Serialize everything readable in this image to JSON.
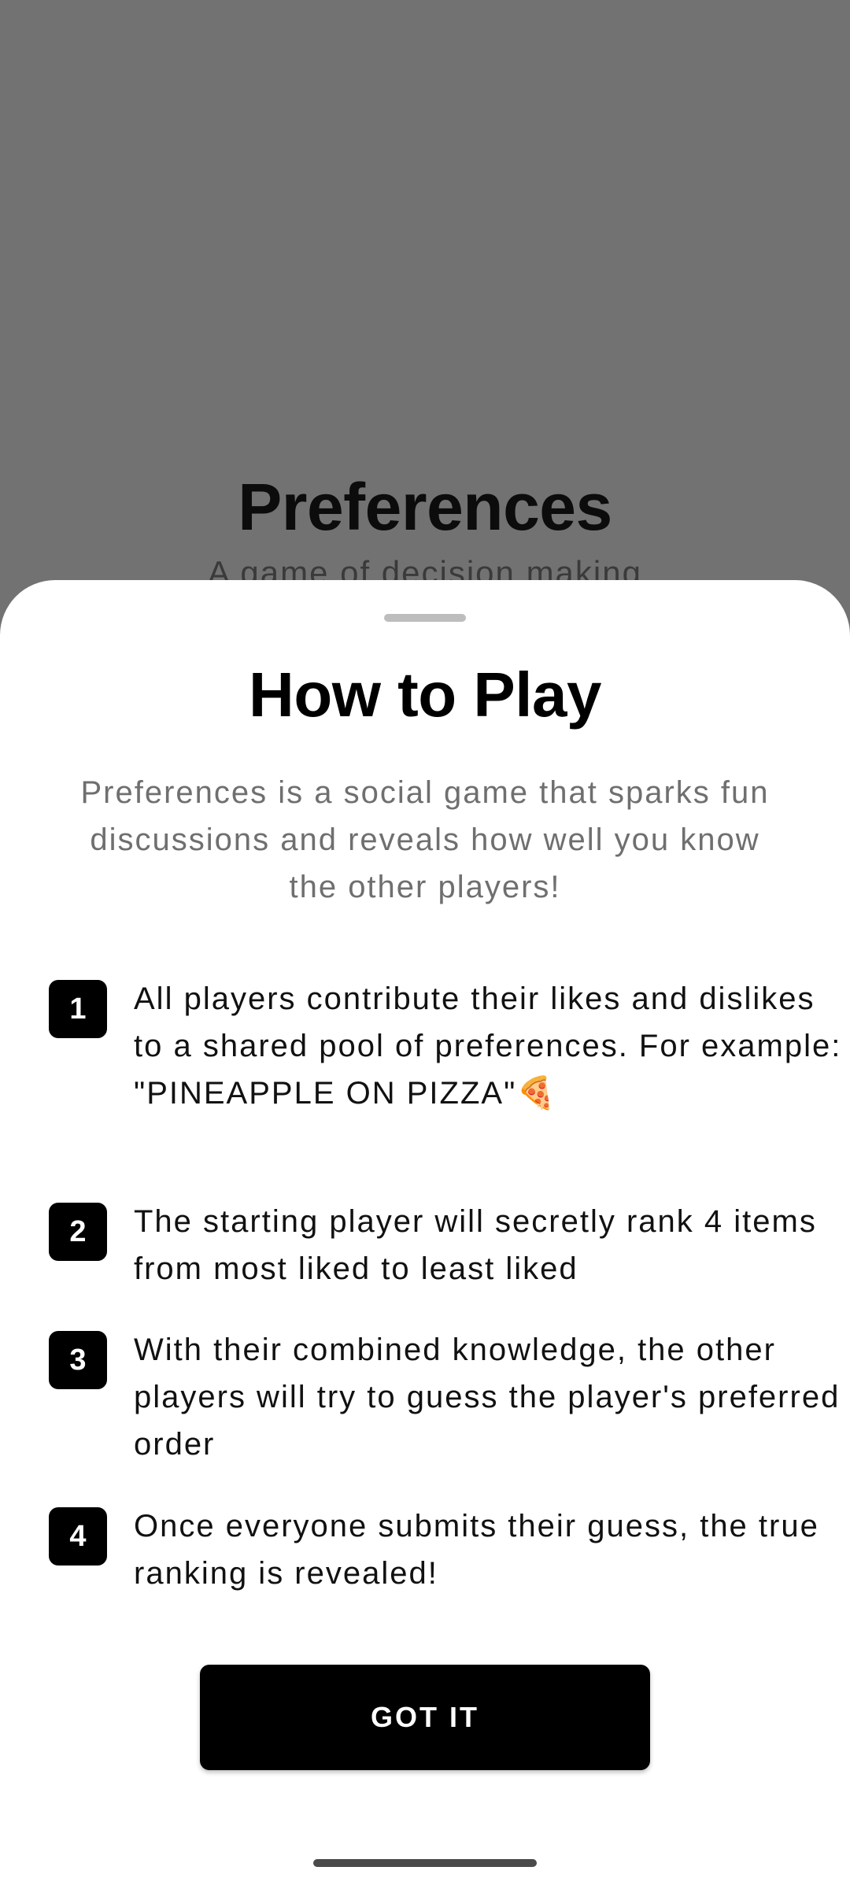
{
  "background": {
    "title": "Preferences",
    "subtitle": "A game of decision making"
  },
  "sheet": {
    "title": "How to Play",
    "intro": "Preferences is a social game that sparks fun discussions and reveals how well you know the other players!",
    "steps": [
      {
        "number": "1",
        "text": "All players contribute their likes and dislikes to a shared pool of preferences. For example: \"PINEAPPLE ON PIZZA\"🍕"
      },
      {
        "number": "2",
        "text": "The starting player will secretly rank 4 items from most liked to least liked"
      },
      {
        "number": "3",
        "text": "With their combined knowledge, the other players will try to guess the player's preferred order"
      },
      {
        "number": "4",
        "text": "Once everyone submits their guess, the true ranking is revealed!"
      }
    ],
    "button_label": "GOT IT"
  },
  "colors": {
    "scrim": "#737272",
    "sheet": "#ffffff",
    "accent": "#000000",
    "intro_text": "#6f6f6f"
  }
}
